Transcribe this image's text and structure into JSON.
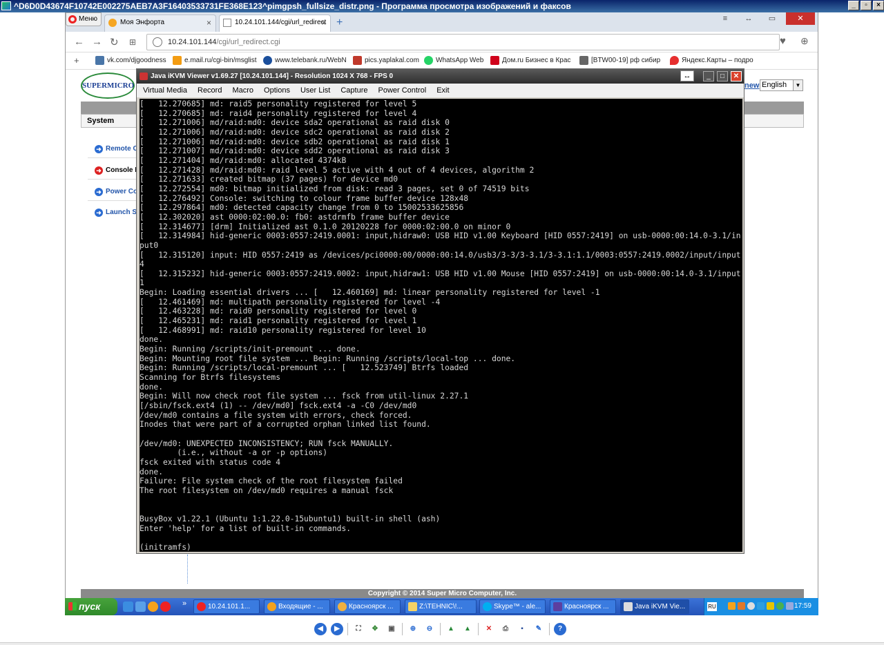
{
  "viewer": {
    "title": "^D6D0D43674F10742E002275AEB7A3F16403533731FE368E123^pimgpsh_fullsize_distr.png - Программа просмотра изображений и факсов"
  },
  "browser": {
    "menu_label": "Меню",
    "tabs": [
      {
        "label": "Моя Энфорта"
      },
      {
        "label": "10.24.101.144/cgi/url_redirect"
      }
    ],
    "address": {
      "host": "10.24.101.144",
      "path": "/cgi/url_redirect.cgi"
    },
    "bookmarks": [
      "vk.com/djgoodness",
      "e.mail.ru/cgi-bin/msglist",
      "www.telebank.ru/WebN",
      "pics.yaplakal.com",
      "WhatsApp Web",
      "Дом.ru Бизнес в Крас",
      "[BTW00-19] рф сибир",
      "Яндекс.Карты – подро"
    ]
  },
  "supermicro": {
    "logo_text": "SUPERMICRO",
    "system_label": "System",
    "links": [
      "Remote C",
      "Console R",
      "Power Co",
      "Launch S"
    ],
    "lang_link": "new",
    "lang_value": "English",
    "copyright": "Copyright © 2014 Super Micro Computer, Inc."
  },
  "kvm": {
    "title": "Java iKVM Viewer v1.69.27 [10.24.101.144]  - Resolution 1024 X 768 - FPS 0",
    "menu": [
      "Virtual Media",
      "Record",
      "Macro",
      "Options",
      "User List",
      "Capture",
      "Power Control",
      "Exit"
    ],
    "console": "[   12.270685] md: raid5 personality registered for level 5\n[   12.270685] md: raid4 personality registered for level 4\n[   12.271006] md/raid:md0: device sda2 operational as raid disk 0\n[   12.271006] md/raid:md0: device sdc2 operational as raid disk 2\n[   12.271006] md/raid:md0: device sdb2 operational as raid disk 1\n[   12.271007] md/raid:md0: device sdd2 operational as raid disk 3\n[   12.271404] md/raid:md0: allocated 4374kB\n[   12.271428] md/raid:md0: raid level 5 active with 4 out of 4 devices, algorithm 2\n[   12.271633] created bitmap (37 pages) for device md0\n[   12.272554] md0: bitmap initialized from disk: read 3 pages, set 0 of 74519 bits\n[   12.276492] Console: switching to colour frame buffer device 128x48\n[   12.297864] md0: detected capacity change from 0 to 15002533625856\n[   12.302020] ast 0000:02:00.0: fb0: astdrmfb frame buffer device\n[   12.314677] [drm] Initialized ast 0.1.0 20120228 for 0000:02:00.0 on minor 0\n[   12.314984] hid-generic 0003:0557:2419.0001: input,hidraw0: USB HID v1.00 Keyboard [HID 0557:2419] on usb-0000:00:14.0-3.1/in\nput0\n[   12.315120] input: HID 0557:2419 as /devices/pci0000:00/0000:00:14.0/usb3/3-3/3-3.1/3-3.1:1.1/0003:0557:2419.0002/input/input\n4\n[   12.315232] hid-generic 0003:0557:2419.0002: input,hidraw1: USB HID v1.00 Mouse [HID 0557:2419] on usb-0000:00:14.0-3.1/input\n1\nBegin: Loading essential drivers ... [   12.460169] md: linear personality registered for level -1\n[   12.461469] md: multipath personality registered for level -4\n[   12.463228] md: raid0 personality registered for level 0\n[   12.465231] md: raid1 personality registered for level 1\n[   12.468991] md: raid10 personality registered for level 10\ndone.\nBegin: Running /scripts/init-premount ... done.\nBegin: Mounting root file system ... Begin: Running /scripts/local-top ... done.\nBegin: Running /scripts/local-premount ... [   12.523749] Btrfs loaded\nScanning for Btrfs filesystems\ndone.\nBegin: Will now check root file system ... fsck from util-linux 2.27.1\n[/sbin/fsck.ext4 (1) -- /dev/md0] fsck.ext4 -a -C0 /dev/md0\n/dev/md0 contains a file system with errors, check forced.\nInodes that were part of a corrupted orphan linked list found.\n\n/dev/md0: UNEXPECTED INCONSISTENCY; RUN fsck MANUALLY.\n        (i.e., without -a or -p options)\nfsck exited with status code 4\ndone.\nFailure: File system check of the root filesystem failed\nThe root filesystem on /dev/md0 requires a manual fsck\n\n\nBusyBox v1.22.1 (Ubuntu 1:1.22.0-15ubuntu1) built-in shell (ash)\nEnter 'help' for a list of built-in commands.\n\n(initramfs)"
  },
  "taskbar": {
    "start_label": "пуск",
    "tasks": [
      "10.24.101.1...",
      "Входящие - ...",
      "Красноярск ...",
      "Z:\\TEHNIC\\!...",
      "Skype™ - ale...",
      "Красноярск ...",
      "Java iKVM Vie..."
    ],
    "tray_lang": "RU",
    "clock": "17:59"
  },
  "colors": {
    "console_bg": "#000000",
    "console_fg": "#d8d8d8",
    "taskbar": "#2453b8",
    "start": "#2f8a2a"
  }
}
